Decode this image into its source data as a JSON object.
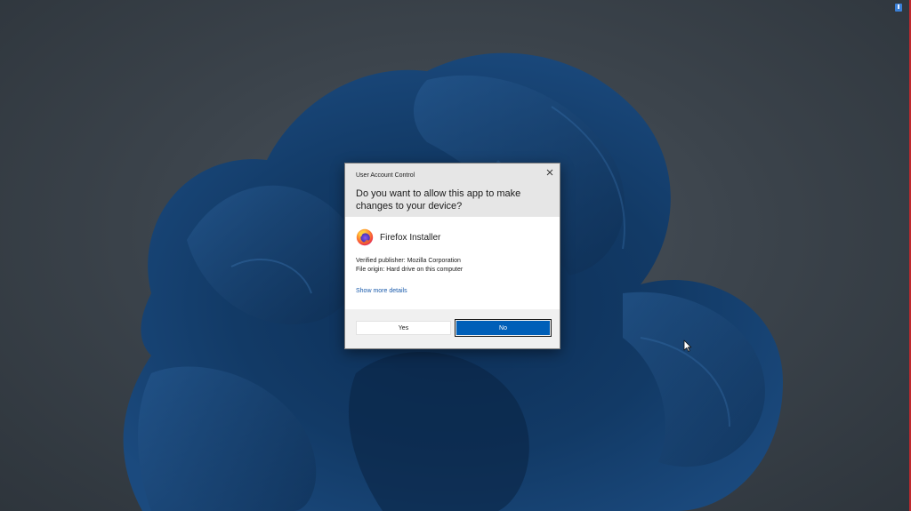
{
  "dialog": {
    "title": "User Account Control",
    "question": "Do you want to allow this app to make changes to your device?",
    "app_name": "Firefox Installer",
    "publisher_line": "Verified publisher: Mozilla Corporation",
    "origin_line": "File origin: Hard drive on this computer",
    "show_more_label": "Show more details",
    "yes_label": "Yes",
    "no_label": "No",
    "close_icon": "close-icon",
    "app_icon": "firefox-icon"
  },
  "colors": {
    "primary_button": "#005fb8",
    "link": "#1a5bab",
    "header_bg": "#e6e6e6",
    "footer_bg": "#f0f0f0",
    "desktop_bg": "#3a4249",
    "wallpaper_bloom": "#123a66",
    "edge_accent": "#c0282d"
  }
}
